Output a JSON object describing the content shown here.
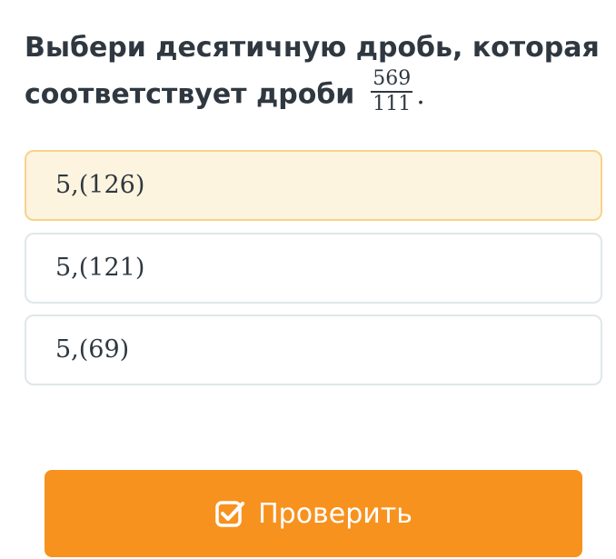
{
  "question": {
    "line1": "Выбери десятичную дробь, которая",
    "line2": "соответствует дроби",
    "fraction": {
      "numerator": "569",
      "denominator": "111"
    },
    "period": "."
  },
  "options": [
    {
      "label": "5,(126)",
      "selected": true
    },
    {
      "label": "5,(121)",
      "selected": false
    },
    {
      "label": "5,(69)",
      "selected": false
    }
  ],
  "check_button": {
    "label": "Проверить",
    "icon": "checkbox-check-icon"
  },
  "colors": {
    "text": "#2f3840",
    "selected_bg": "#fdf4df",
    "selected_border": "#f6d38a",
    "option_border": "#dfe7ea",
    "button_bg": "#f7921f",
    "button_text": "#ffffff"
  }
}
